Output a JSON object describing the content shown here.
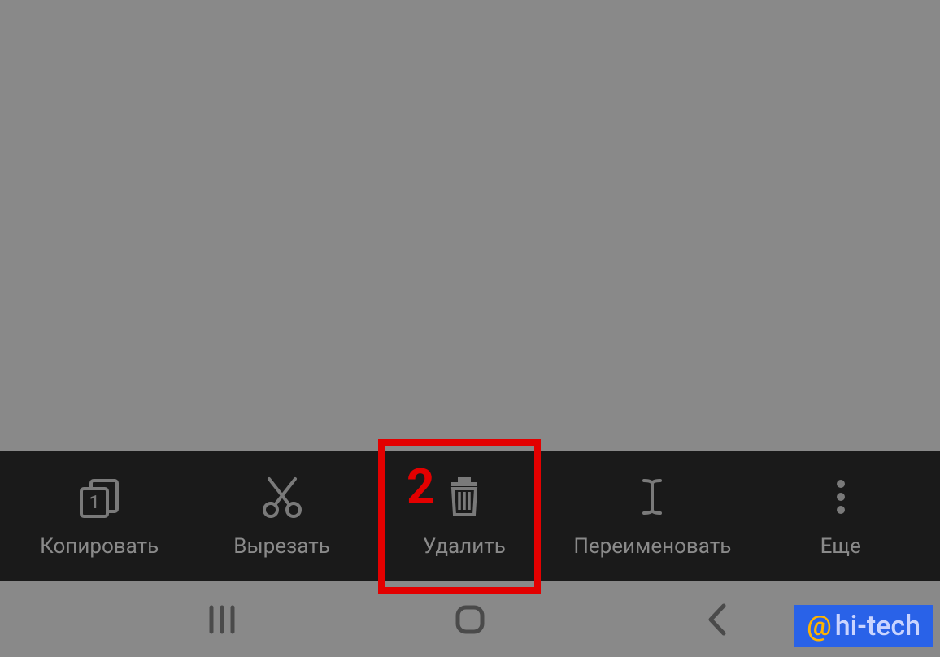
{
  "annotation": {
    "number": "2"
  },
  "toolbar": {
    "copy": {
      "label": "Копировать"
    },
    "cut": {
      "label": "Вырезать"
    },
    "delete": {
      "label": "Удалить"
    },
    "rename": {
      "label": "Переименовать"
    },
    "more": {
      "label": "Еще"
    }
  },
  "watermark": {
    "at": "@",
    "text": "hi-tech"
  }
}
